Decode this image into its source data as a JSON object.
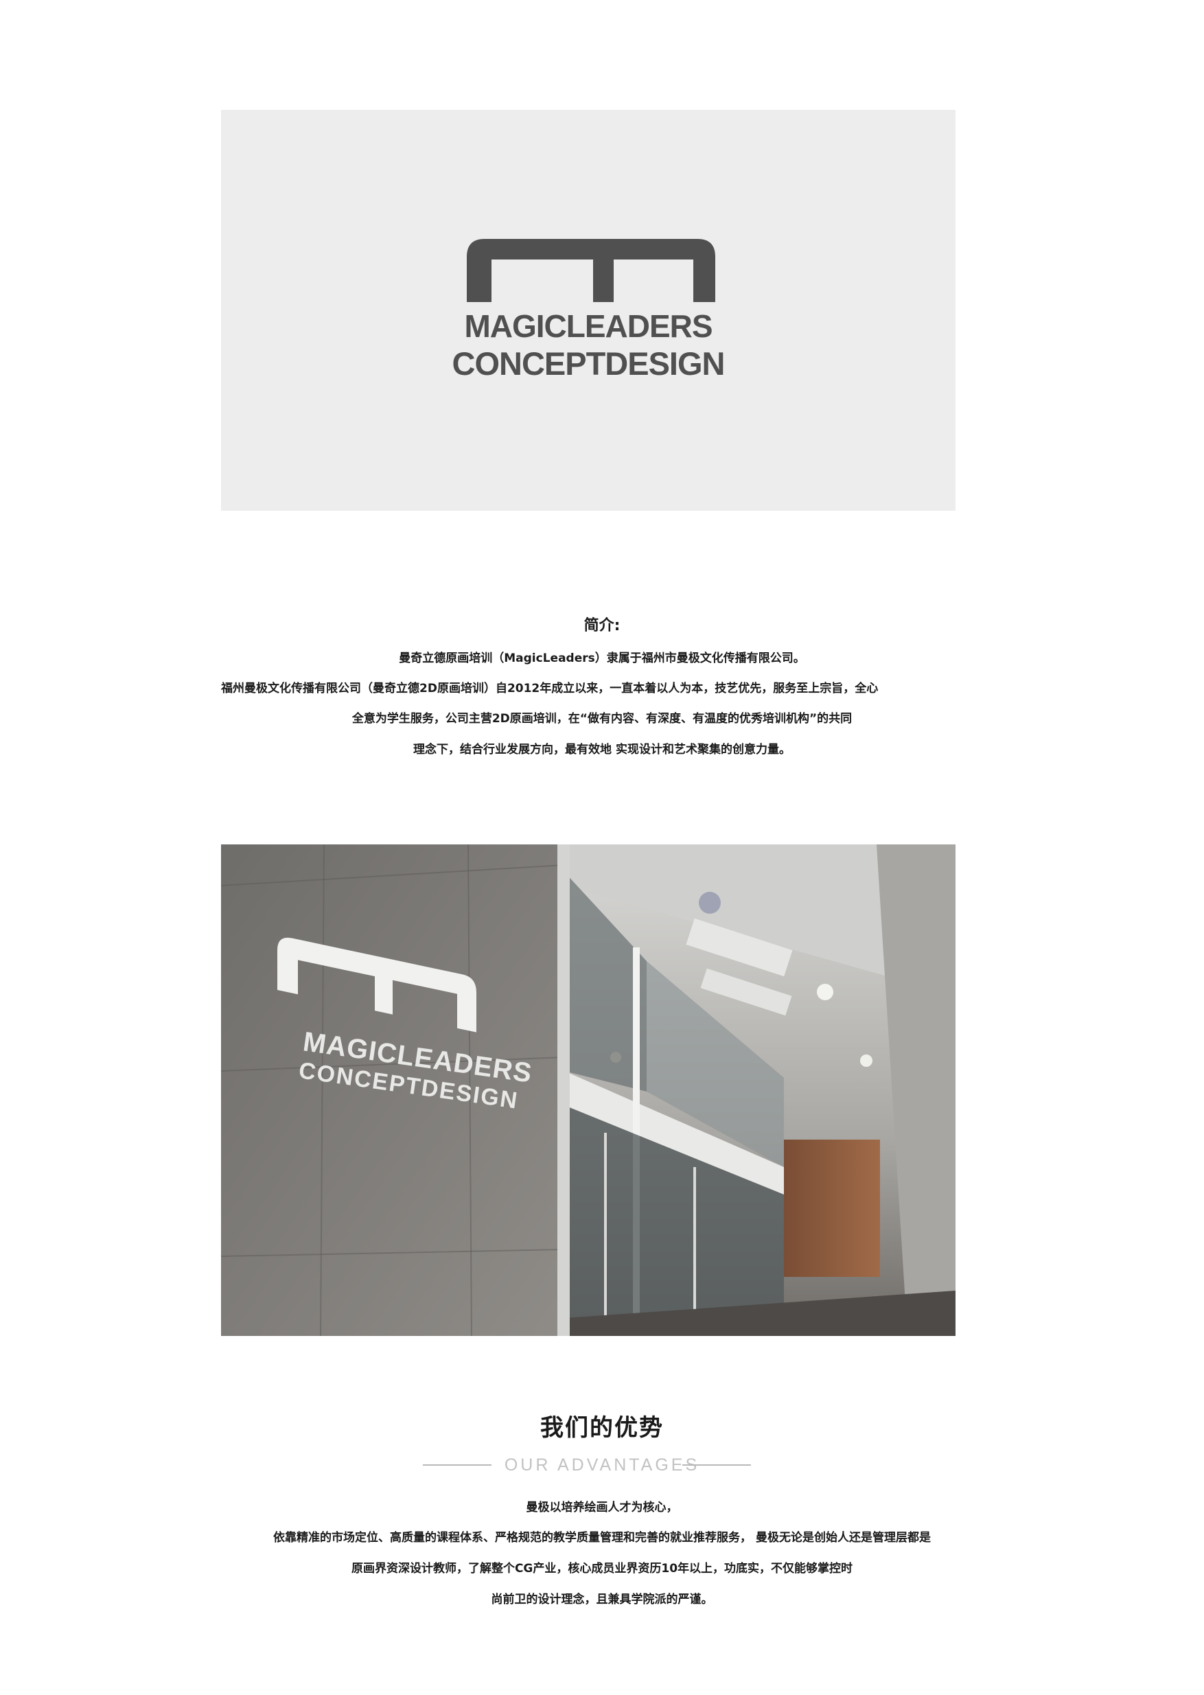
{
  "logo": {
    "icon": "magicleaders-m-mark-icon",
    "line1": "MAGICLEADERS",
    "line2": "CONCEPTDESIGN",
    "color": "#505050"
  },
  "intro": {
    "heading": "简介:",
    "lines": [
      "曼奇立德原画培训（MagicLeaders）隶属于福州市曼极文化传播有限公司。",
      "福州曼极文化传播有限公司（曼奇立德2D原画培训）自2012年成立以来，一直本着以人为本，技艺优先，服务至上宗旨，全心",
      "全意为学生服务，公司主营2D原画培训，在“做有内容、有深度、有温度的优秀培训机构”的共同",
      "理念下，结合行业发展方向，最有效地 实现设计和艺术聚集的创意力量。"
    ]
  },
  "photo": {
    "sign_line1": "MAGICLEADERS",
    "sign_line2": "CONCEPTDESIGN"
  },
  "advantages": {
    "title": "我们的优势",
    "subtitle": "OUR ADVANTAGES",
    "lines": [
      "曼极以培养绘画人才为核心，",
      "依靠精准的市场定位、高质量的课程体系、严格规范的教学质量管理和完善的就业推荐服务，  曼极无论是创始人还是管理层都是",
      "原画界资深设计教师，了解整个CG产业，核心成员业界资历10年以上，功底实，不仅能够掌控时",
      "尚前卫的设计理念，且兼具学院派的严谨。"
    ]
  }
}
